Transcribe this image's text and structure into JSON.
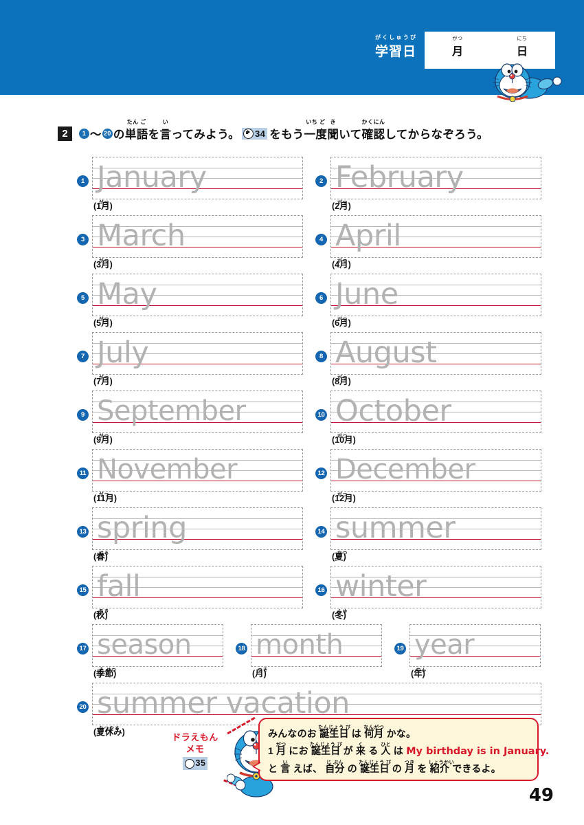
{
  "header": {
    "study_date_label": "学習日",
    "study_date_ruby": "がくしゅうび",
    "month_unit": "月",
    "month_ruby": "がつ",
    "day_unit": "日",
    "day_ruby": "にち",
    "bg_color": "#0b72bb"
  },
  "instruction": {
    "task_number": "2",
    "circle_from": "1",
    "circle_to": "20",
    "seg1_tilde": "〜",
    "seg2": "の単語を言ってみよう。",
    "seg2_ruby_a": "たん ご",
    "seg2_ruby_b": "い",
    "audio_track": "34",
    "seg3": "をもう一度聞いて確認してからなぞろう。",
    "seg3_ruby_a": "いち ど  き",
    "seg3_ruby_b": "かくにん",
    "part_a": "の",
    "part_b": "単語",
    "part_b_ruby": "たん ご",
    "part_c": "を",
    "part_d": "言",
    "part_d_ruby": "い",
    "part_e": "ってみよう。",
    "part_f": "をもう",
    "part_g": "一度",
    "part_g_ruby": "いち ど",
    "part_h": "聞",
    "part_h_ruby": "き",
    "part_i": "いて",
    "part_j": "確認",
    "part_j_ruby": "かくにん",
    "part_k": "してからなぞろう。"
  },
  "items": [
    {
      "num": "1",
      "word": "January",
      "jp": "(1月)",
      "ruby": "がつ"
    },
    {
      "num": "2",
      "word": "February",
      "jp": "(2月)",
      "ruby": "がつ"
    },
    {
      "num": "3",
      "word": "March",
      "jp": "(3月)",
      "ruby": "がつ"
    },
    {
      "num": "4",
      "word": "April",
      "jp": "(4月)",
      "ruby": "がつ"
    },
    {
      "num": "5",
      "word": "May",
      "jp": "(5月)",
      "ruby": "がつ"
    },
    {
      "num": "6",
      "word": "June",
      "jp": "(6月)",
      "ruby": "がつ"
    },
    {
      "num": "7",
      "word": "July",
      "jp": "(7月)",
      "ruby": "がつ"
    },
    {
      "num": "8",
      "word": "August",
      "jp": "(8月)",
      "ruby": "がつ"
    },
    {
      "num": "9",
      "word": "September",
      "jp": "(9月)",
      "ruby": "がつ"
    },
    {
      "num": "10",
      "word": "October",
      "jp": "(10月)",
      "ruby": "がつ"
    },
    {
      "num": "11",
      "word": "November",
      "jp": "(11月)",
      "ruby": "がつ"
    },
    {
      "num": "12",
      "word": "December",
      "jp": "(12月)",
      "ruby": "がつ"
    },
    {
      "num": "13",
      "word": "spring",
      "jp": "(春)",
      "ruby": "はる"
    },
    {
      "num": "14",
      "word": "summer",
      "jp": "(夏)",
      "ruby": "なつ"
    },
    {
      "num": "15",
      "word": "fall",
      "jp": "(秋)",
      "ruby": "あき"
    },
    {
      "num": "16",
      "word": "winter",
      "jp": "(冬)",
      "ruby": "ふゆ"
    },
    {
      "num": "17",
      "word": "season",
      "jp": "(季節)",
      "ruby": "き せつ"
    },
    {
      "num": "18",
      "word": "month",
      "jp": "(月)",
      "ruby": "つき"
    },
    {
      "num": "19",
      "word": "year",
      "jp": "(年)",
      "ruby": "ねん"
    },
    {
      "num": "20",
      "word": "summer vacation",
      "jp": "(夏休み)",
      "ruby": "なつやす"
    }
  ],
  "memo": {
    "label_line1": "ドラえもん",
    "label_line2": "メモ",
    "audio_track": "35",
    "label_color": "#d7182a",
    "bubble_bg": "#fdf6da",
    "line1_a": "みんなのお",
    "line1_b": "誕生日",
    "line1_b_ruby": "たんじょう び",
    "line1_c": "は",
    "line1_d": "何月",
    "line1_d_ruby": "なんがつ",
    "line1_e": "かな。",
    "line2_a": "1",
    "line2_b": "月",
    "line2_b_ruby": "がつ",
    "line2_c": "にお",
    "line2_d": "誕生日",
    "line2_d_ruby": "たんじょう び",
    "line2_e": "が",
    "line2_f": "来",
    "line2_f_ruby": "く",
    "line2_g": "る",
    "line2_h": "人",
    "line2_h_ruby": "ひと",
    "line2_i": "は",
    "line2_english": "My birthday is in January.",
    "line3_a": "と",
    "line3_b": "言",
    "line3_b_ruby": "い",
    "line3_c": "えば、",
    "line3_d": "自分",
    "line3_d_ruby": "じ ぶん",
    "line3_e": "の",
    "line3_f": "誕生日",
    "line3_f_ruby": "たんじょう び",
    "line3_g": "の",
    "line3_h": "月",
    "line3_h_ruby": "つき",
    "line3_i": "を",
    "line3_j": "紹介",
    "line3_j_ruby": "しょうかい",
    "line3_k": "できるよ。"
  },
  "page_number": "49"
}
